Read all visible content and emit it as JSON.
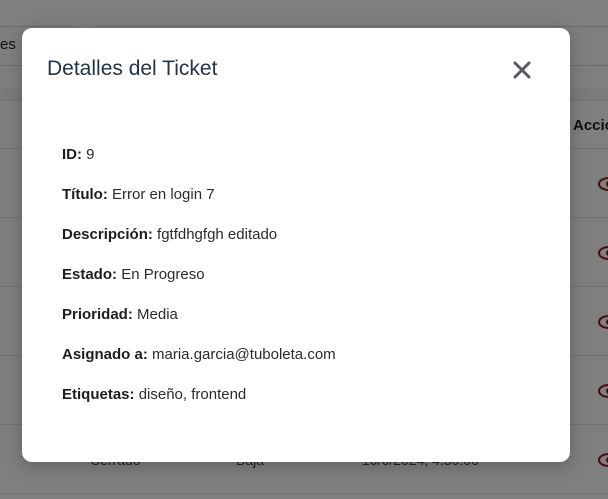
{
  "background": {
    "filter_text": "es",
    "table_header_actions": "Accio",
    "faint_row": {
      "status": "Cerrado",
      "priority": "Baja",
      "date": "10/6/2024, 4:30:06"
    }
  },
  "modal": {
    "title": "Detalles del Ticket",
    "close_icon": "close-icon",
    "fields": [
      {
        "label": "ID:",
        "value": "9"
      },
      {
        "label": "Título:",
        "value": "Error en login 7"
      },
      {
        "label": "Descripción:",
        "value": "fgtfdhgfgh editado"
      },
      {
        "label": "Estado:",
        "value": "En Progreso"
      },
      {
        "label": "Prioridad:",
        "value": "Media"
      },
      {
        "label": "Asignado a:",
        "value": "maria.garcia@tuboleta.com"
      },
      {
        "label": "Etiquetas:",
        "value": "diseño, frontend"
      }
    ]
  },
  "colors": {
    "title": "#243447",
    "overlay": "rgba(0,0,0,0.5)",
    "eye_icon": "#8b1a1a"
  }
}
